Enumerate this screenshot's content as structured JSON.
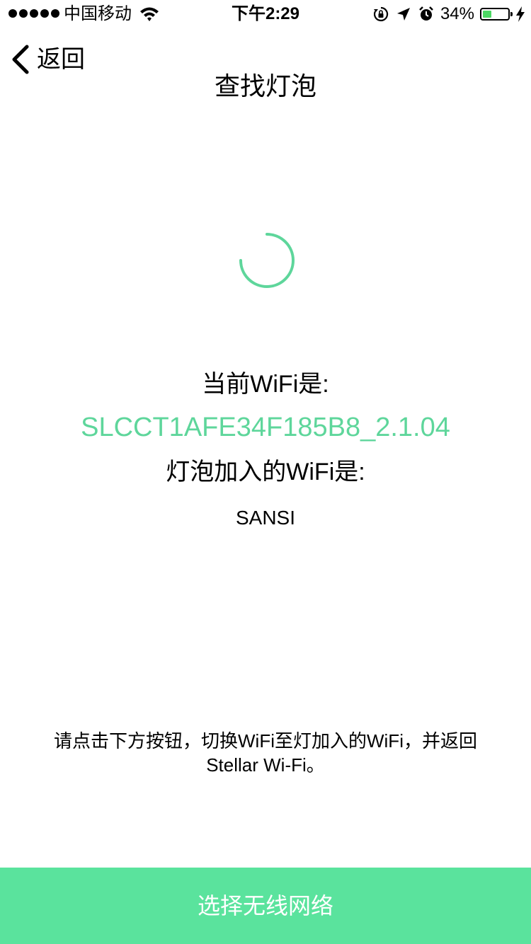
{
  "status_bar": {
    "carrier": "中国移动",
    "time": "下午2:29",
    "battery_percent": "34%",
    "battery_level": 0.34,
    "battery_color": "#4cd964",
    "icons": [
      "signal-dots-icon",
      "wifi-icon",
      "orientation-lock-icon",
      "location-arrow-icon",
      "alarm-icon",
      "battery-icon",
      "charging-bolt-icon"
    ]
  },
  "nav": {
    "back_label": "返回",
    "title": "查找灯泡",
    "back_icon": "chevron-left-icon"
  },
  "spinner": {
    "color": "#5ed69b",
    "icon": "loading-spinner-icon"
  },
  "content": {
    "current_wifi_label": "当前WiFi是:",
    "current_wifi_value": "SLCCT1AFE34F185B8_2.1.04",
    "bulb_wifi_label": "灯泡加入的WiFi是:",
    "bulb_wifi_value": "SANSI",
    "instruction_line1": "请点击下方按钮，切换WiFi至灯加入的WiFi，并返回",
    "instruction_line2": "Stellar Wi-Fi。"
  },
  "action": {
    "button_label": "选择无线网络",
    "button_color": "#5ae39d"
  }
}
